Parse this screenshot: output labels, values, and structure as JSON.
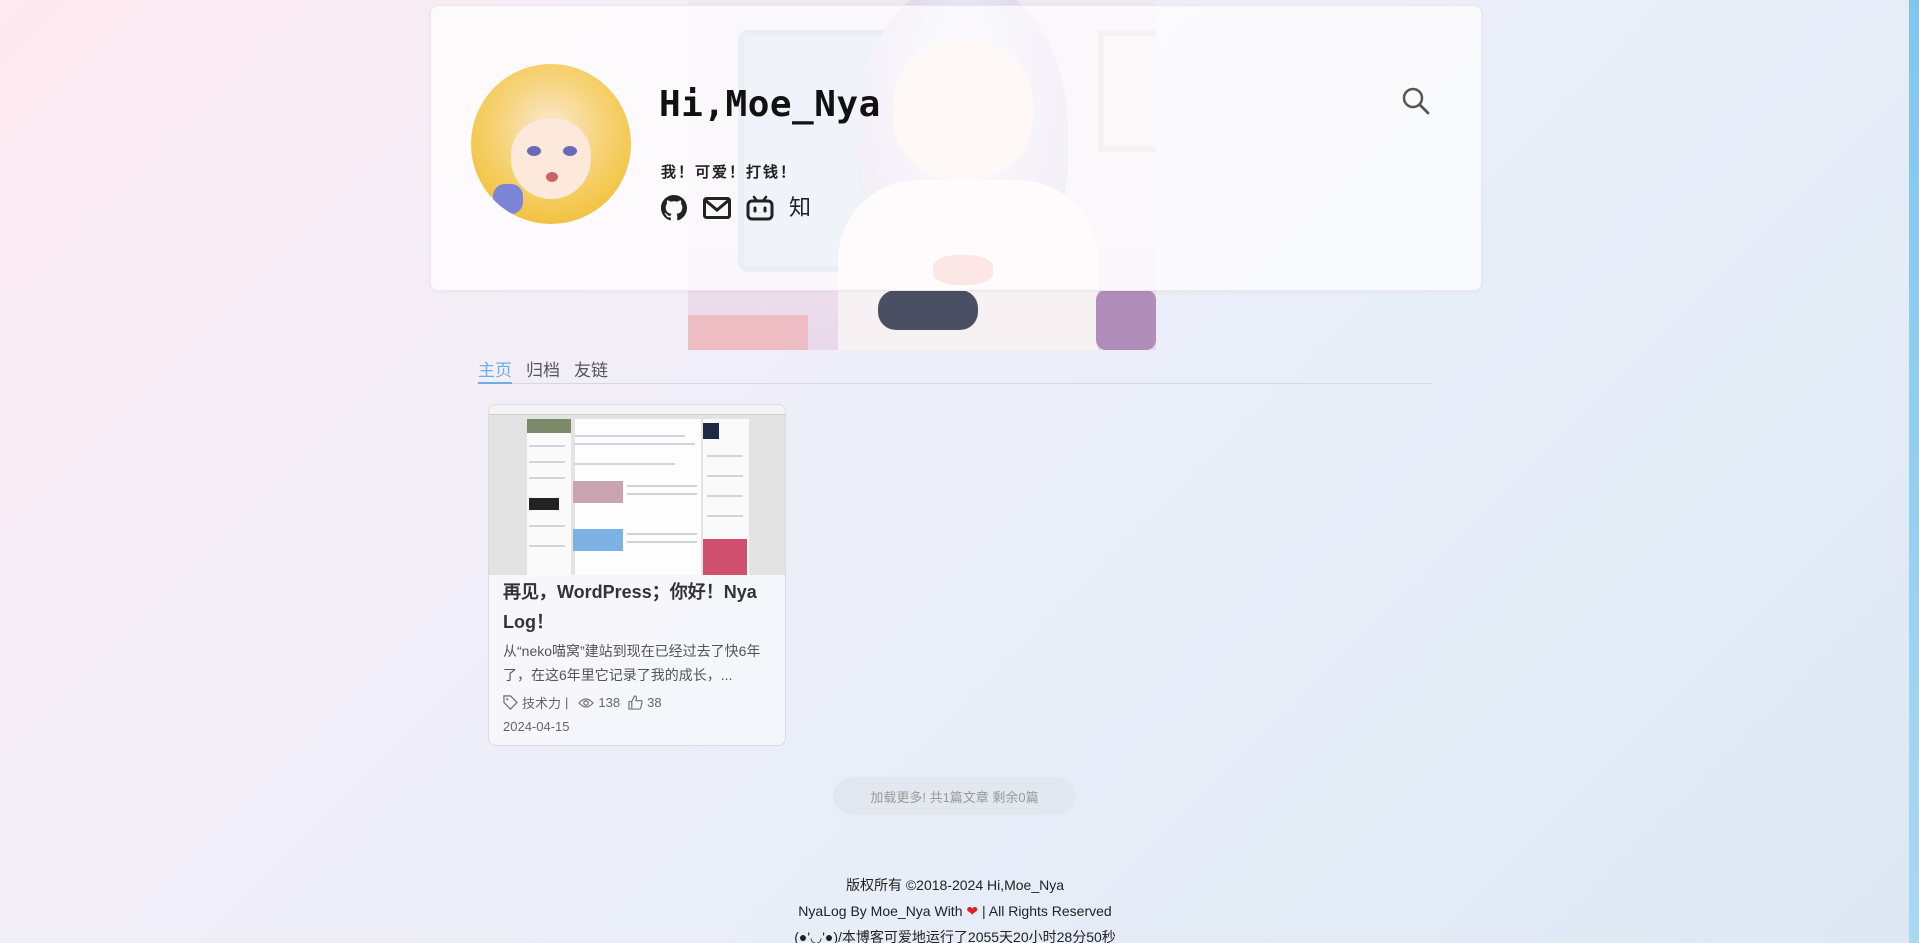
{
  "header": {
    "title": "Hi,Moe_Nya",
    "motto": "我！可爱！打钱！",
    "social_zhihu": "知",
    "icons": [
      "github-icon",
      "mail-icon",
      "bilibili-icon",
      "search-icon"
    ]
  },
  "nav": {
    "tabs": [
      {
        "label": "主页",
        "active": true
      },
      {
        "label": "归档",
        "active": false
      },
      {
        "label": "友链",
        "active": false
      }
    ]
  },
  "posts": [
    {
      "title": "再见，WordPress；你好！Nya Log！",
      "excerpt": "从“neko喵窝”建站到现在已经过去了快6年了，在这6年里它记录了我的成长，...",
      "category": "技术力",
      "separator": "|",
      "views": "138",
      "likes": "38",
      "date": "2024-04-15"
    }
  ],
  "load_more": "加载更多! 共1篇文章 剩余0篇",
  "footer": {
    "copyright": "版权所有 ©2018-2024 Hi,Moe_Nya",
    "credit_prefix": "NyaLog By Moe_Nya With",
    "heart": "❤",
    "credit_suffix": "| All Rights Reserved",
    "uptime": "(●'◡'●)/本博客可爱地运行了2055天20小时28分50秒"
  },
  "colors": {
    "accent": "#6eaee6",
    "heart": "#e02020",
    "text": "#222222"
  }
}
